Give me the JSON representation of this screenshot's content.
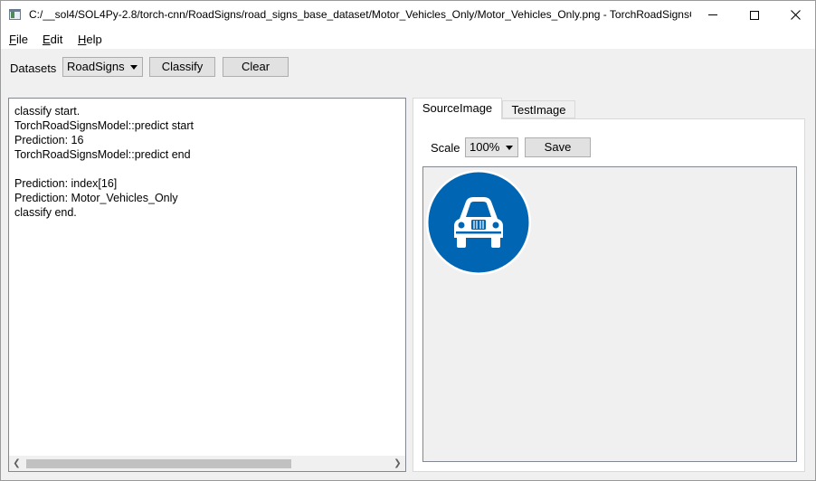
{
  "window": {
    "title": "C:/__sol4/SOL4Py-2.8/torch-cnn/RoadSigns/road_signs_base_dataset/Motor_Vehicles_Only/Motor_Vehicles_Only.png - TorchRoadSignsCl..."
  },
  "menu": {
    "file": {
      "mnemonic": "F",
      "rest": "ile"
    },
    "edit": {
      "mnemonic": "E",
      "rest": "dit"
    },
    "help": {
      "mnemonic": "H",
      "rest": "elp"
    }
  },
  "toolbar": {
    "datasets_label": "Datasets",
    "dataset_selected": "RoadSigns",
    "classify_label": "Classify",
    "clear_label": "Clear"
  },
  "log": {
    "text": "classify start.\nTorchRoadSignsModel::predict start\nPrediction: 16\nTorchRoadSignsModel::predict end\n\nPrediction: index[16]\nPrediction: Motor_Vehicles_Only\nclassify end."
  },
  "tabs": [
    {
      "label": "SourceImage",
      "active": true
    },
    {
      "label": "TestImage",
      "active": false
    }
  ],
  "image_panel": {
    "scale_label": "Scale",
    "scale_value": "100%",
    "save_label": "Save"
  },
  "icons": {
    "app": "app-window-icon",
    "sign": "motor-vehicles-only-sign",
    "sign_color": "#0065b3"
  }
}
